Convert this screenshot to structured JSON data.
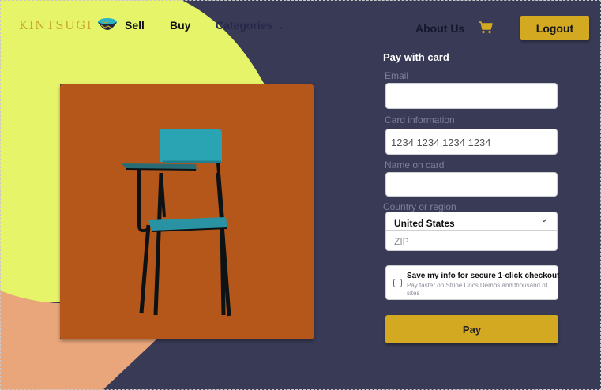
{
  "nav": {
    "logo_text": "KINTSUGI",
    "logo_icon": "kintsugi-bowl-icon",
    "sell_label": "Sell",
    "buy_label": "Buy",
    "categories_label": "Categories",
    "categories_chevron": "⌄",
    "about_label": "About Us",
    "cart_icon": "cart-icon",
    "logout_label": "Logout"
  },
  "product": {
    "image_subject": "chair-icon"
  },
  "payment": {
    "title": "Pay with card",
    "email_label": "Email",
    "email_value": "",
    "card_label": "Card information",
    "card_placeholder": "1234 1234 1234 1234",
    "name_label": "Name on card",
    "name_value": "",
    "country_label": "Country or region",
    "country_value": "United States",
    "country_chevron": "⌄",
    "zip_placeholder": "ZIP",
    "save_title": "Save my info for secure 1-click checkout",
    "save_subtitle": "Pay faster on Stripe Docs Demos and thousand of sites",
    "pay_label": "Pay"
  },
  "colors": {
    "background": "#383a56",
    "yellow_blob": "#e6f46a",
    "peach_blob": "#e8a67a",
    "photo_bg": "#b5561a",
    "accent": "#d2a920",
    "chair_teal": "#2aa3b3"
  }
}
